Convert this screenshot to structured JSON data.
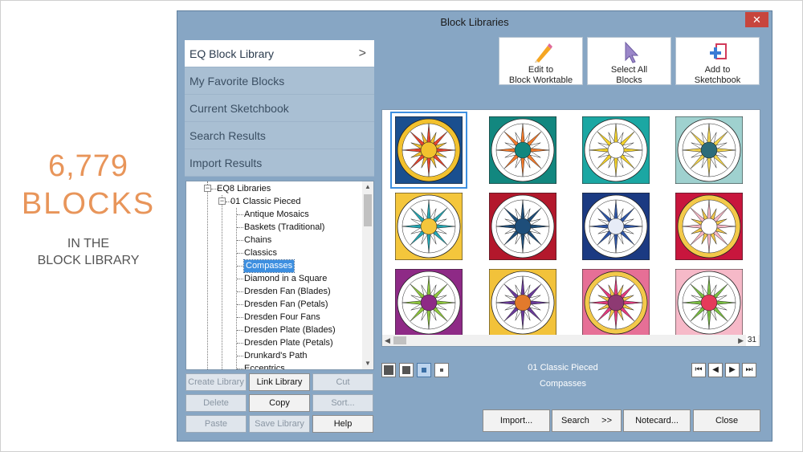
{
  "promo": {
    "count": "6,779",
    "blocks": "BLOCKS",
    "sub1": "IN THE",
    "sub2": "BLOCK LIBRARY",
    "accent": "#e8955a"
  },
  "dialog": {
    "title": "Block Libraries",
    "close_label": "✕"
  },
  "nav": {
    "items": [
      {
        "label": "EQ Block Library",
        "chevron": ">"
      },
      {
        "label": "My Favorite Blocks"
      },
      {
        "label": "Current Sketchbook"
      },
      {
        "label": "Search Results"
      },
      {
        "label": "Import Results"
      }
    ]
  },
  "tree": {
    "root": "EQ8 Libraries",
    "group": "01 Classic Pieced",
    "items": [
      "Antique Mosaics",
      "Baskets (Traditional)",
      "Chains",
      "Classics",
      "Compasses",
      "Diamond in a Square",
      "Dresden Fan (Blades)",
      "Dresden Fan (Petals)",
      "Dresden Four Fans",
      "Dresden Plate (Blades)",
      "Dresden Plate (Petals)",
      "Drunkard's Path",
      "Eccentrics"
    ],
    "selected": "Compasses"
  },
  "left_buttons": {
    "create": "Create Library",
    "link": "Link Library",
    "cut": "Cut",
    "delete": "Delete",
    "copy": "Copy",
    "sort": "Sort...",
    "paste": "Paste",
    "save": "Save Library",
    "help": "Help"
  },
  "toolbar": {
    "edit": {
      "l1": "Edit to",
      "l2": "Block Worktable",
      "icon": "pencil-icon"
    },
    "select_all": {
      "l1": "Select All",
      "l2": "Blocks",
      "icon": "cursor-icon"
    },
    "add": {
      "l1": "Add to",
      "l2": "Sketchbook",
      "icon": "add-sketchbook-icon"
    }
  },
  "grid": {
    "page_count": "31",
    "blocks": [
      {
        "bg": "#1a4f8f",
        "ring": "#f2c12e",
        "star": "#e7452f",
        "center": "#f2c12e"
      },
      {
        "bg": "#12877f",
        "ring": "#ffffff",
        "star": "#f37a2b",
        "center": "#12877f"
      },
      {
        "bg": "#1ba7a3",
        "ring": "#ffffff",
        "star": "#f5d32b",
        "center": "#ffffff"
      },
      {
        "bg": "#9fd1cf",
        "ring": "#ffffff",
        "star": "#f5d64f",
        "center": "#2d6c7a"
      },
      {
        "bg": "#f4c63c",
        "ring": "#ffffff",
        "star": "#25a7b3",
        "center": "#f4c63c"
      },
      {
        "bg": "#b3182c",
        "ring": "#ffffff",
        "star": "#1e4e7a",
        "center": "#1e4e7a"
      },
      {
        "bg": "#1b3a82",
        "ring": "#ffffff",
        "star": "#2f56a6",
        "center": "#e7ecf7"
      },
      {
        "bg": "#c8163d",
        "ring": "#f3c94a",
        "star": "#f6b7c5",
        "center": "#ffffff"
      },
      {
        "bg": "#8e2a86",
        "ring": "#ffffff",
        "star": "#8fc83e",
        "center": "#8e2a86"
      },
      {
        "bg": "#f2c23a",
        "ring": "#ffffff",
        "star": "#6a3a9a",
        "center": "#e27a2c"
      },
      {
        "bg": "#e66f96",
        "ring": "#f3c94a",
        "star": "#e43a7d",
        "center": "#8e3a73"
      },
      {
        "bg": "#f6b9c8",
        "ring": "#ffffff",
        "star": "#7bc043",
        "center": "#e53a5a"
      }
    ]
  },
  "info": {
    "line1": "01 Classic Pieced",
    "line2": "Compasses"
  },
  "bottom_buttons": {
    "import": "Import...",
    "search": "Search",
    "search_arrow": ">>",
    "notecard": "Notecard...",
    "close": "Close"
  }
}
